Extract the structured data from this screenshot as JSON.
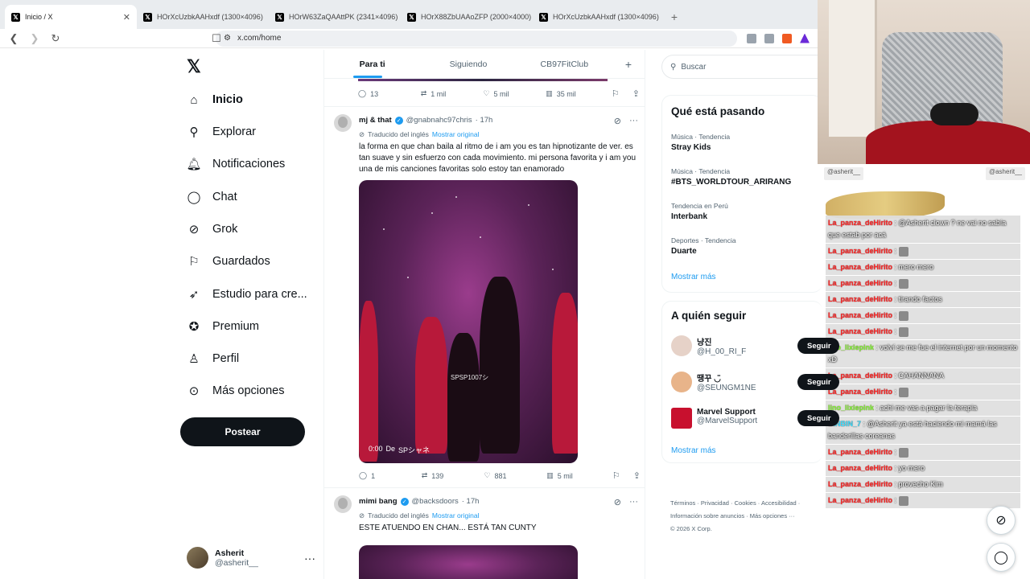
{
  "browser": {
    "tabs": [
      {
        "title": "Inicio / X",
        "active": true
      },
      {
        "title": "HOrXcUzbkAAHxdf (1300×4096)"
      },
      {
        "title": "HOrW63ZaQAAttPK (2341×4096)"
      },
      {
        "title": "HOrX88ZbUAAoZFP (2000×4000)"
      },
      {
        "title": "HOrXcUzbkAAHxdf (1300×4096)"
      }
    ],
    "url": "x.com/home"
  },
  "sidebar": {
    "items": [
      {
        "label": "Inicio",
        "icon": "home-icon"
      },
      {
        "label": "Explorar",
        "icon": "search-icon"
      },
      {
        "label": "Notificaciones",
        "icon": "bell-icon"
      },
      {
        "label": "Chat",
        "icon": "chat-icon"
      },
      {
        "label": "Grok",
        "icon": "grok-icon"
      },
      {
        "label": "Guardados",
        "icon": "bookmark-icon"
      },
      {
        "label": "Estudio para cre...",
        "icon": "rocket-icon"
      },
      {
        "label": "Premium",
        "icon": "premium-icon"
      },
      {
        "label": "Perfil",
        "icon": "person-icon"
      },
      {
        "label": "Más opciones",
        "icon": "more-icon"
      }
    ],
    "post_label": "Postear",
    "user": {
      "name": "Asherit",
      "handle": "@asherit__"
    }
  },
  "feed": {
    "tabs": [
      "Para ti",
      "Siguiendo",
      "CB97FitClub"
    ],
    "top_actions": {
      "replies": "13",
      "reposts": "1 mil",
      "likes": "5 mil",
      "views": "35 mil"
    },
    "tweets": [
      {
        "name": "mj & that",
        "handle": "@gnabnahc97chris",
        "time": "· 17h",
        "translated": "Traducido del inglés",
        "show_original": "Mostrar original",
        "text": "la forma en que chan baila al ritmo de i am you es tan hipnotizante de ver. es tan suave y sin esfuerzo con cada movimiento. mi persona favorita y i am you una de mis canciones favoritas solo estoy tan enamorado",
        "video_time": "0:00",
        "video_caption": "De",
        "video_source": "SPシャネ",
        "watermark": "SPSP1007シ",
        "actions": {
          "replies": "1",
          "reposts": "139",
          "likes": "881",
          "views": "5 mil"
        }
      },
      {
        "name": "mimi bang",
        "handle": "@backsdoors",
        "time": "· 17h",
        "translated": "Traducido del inglés",
        "show_original": "Mostrar original",
        "text": "ESTE ATUENDO EN CHAN... ESTÁ TAN CUNTY"
      }
    ]
  },
  "right": {
    "search_placeholder": "Buscar",
    "trends_title": "Qué está pasando",
    "trends": [
      {
        "meta": "Música · Tendencia",
        "name": "Stray Kids"
      },
      {
        "meta": "Música · Tendencia",
        "name": "#BTS_WORLDTOUR_ARIRANG"
      },
      {
        "meta": "Tendencia en Perú",
        "name": "Interbank"
      },
      {
        "meta": "Deportes · Tendencia",
        "name": "Duarte"
      }
    ],
    "show_more": "Mostrar más",
    "follow_title": "A quién seguir",
    "follow": [
      {
        "name": "냥진",
        "handle": "@H_00_RI_F"
      },
      {
        "name": "땡꾸 ◡̈",
        "handle": "@SEUNGM1NE"
      },
      {
        "name": "Marvel Support",
        "handle": "@MarvelSupport"
      }
    ],
    "follow_button": "Seguir",
    "footer_line1": "Términos · Privacidad · Cookies · Accesibilidad ·",
    "footer_line2": "Información sobre anuncios · Más opciones ···",
    "footer_line3": "© 2026 X Corp."
  },
  "overlay": {
    "chat_left": "@asherit__",
    "chat_right": "@asherit__",
    "messages": [
      {
        "user": "La_panza_deHirito",
        "text": ": @Asherit clown ? ne vai no sabía que estab por acá"
      },
      {
        "user": "La_panza_deHirito",
        "text": ":"
      },
      {
        "user": "La_panza_deHirito",
        "text": ": mero mero"
      },
      {
        "user": "La_panza_deHirito",
        "text": ":"
      },
      {
        "user": "La_panza_deHirito",
        "text": ": tirando factos"
      },
      {
        "user": "La_panza_deHirito",
        "text": ":"
      },
      {
        "user": "La_panza_deHirito",
        "text": ":"
      },
      {
        "user": "lino_lixiepink",
        "text": ": volví se me fue el internet por un momento xD",
        "color": "g"
      },
      {
        "user": "La_panza_deHirito",
        "text": ": CAHANNANA"
      },
      {
        "user": "La_panza_deHirito",
        "text": ":"
      },
      {
        "user": "lino_lixiepink",
        "text": ": achi me vas a pagar la terapia",
        "color": "g"
      },
      {
        "user": "BINBIN_7",
        "text": ": @Asherit ya está haciendo mi mamá las banderillas coreanas",
        "color": "c"
      },
      {
        "user": "La_panza_deHirito",
        "text": ":"
      },
      {
        "user": "La_panza_deHirito",
        "text": ": yo mero"
      },
      {
        "user": "La_panza_deHirito",
        "text": ": provecho Kim"
      },
      {
        "user": "La_panza_deHirito",
        "text": ":"
      }
    ]
  }
}
